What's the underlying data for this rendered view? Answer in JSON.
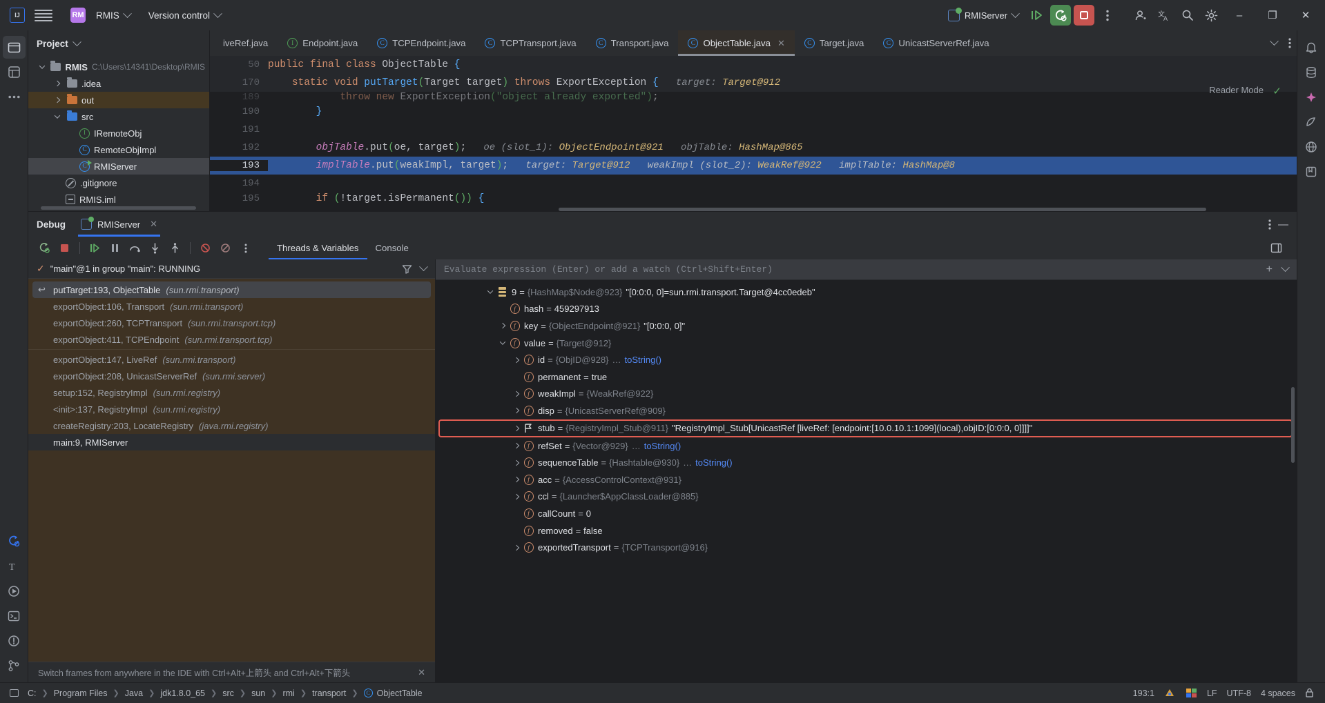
{
  "titlebar": {
    "logo_alt": "intellij-idea-logo",
    "project_badge": "RM",
    "project_name": "RMIS",
    "vcs_label": "Version control",
    "run_config": "RMIServer",
    "buttons": {
      "run": "Run",
      "debug": "Debug",
      "stop": "Stop",
      "more": "More Actions",
      "account": "Account",
      "translate": "Translate",
      "search": "Search Everywhere",
      "settings": "Settings",
      "minimize": "–",
      "maximize": "❐",
      "close": "✕"
    }
  },
  "project_pane": {
    "title": "Project",
    "tree": [
      {
        "label": "RMIS",
        "path": "C:\\Users\\14341\\Desktop\\RMIS",
        "icon": "module-folder-icon",
        "arrow": "down",
        "indent": 0,
        "bold": true,
        "state": "normal"
      },
      {
        "label": ".idea",
        "path": "",
        "icon": "folder-grey-icon",
        "arrow": "right",
        "indent": 1,
        "bold": false,
        "state": "normal"
      },
      {
        "label": "out",
        "path": "",
        "icon": "folder-orange-icon",
        "arrow": "right",
        "indent": 1,
        "bold": false,
        "state": "out-highlight"
      },
      {
        "label": "src",
        "path": "",
        "icon": "folder-blue-icon",
        "arrow": "down",
        "indent": 1,
        "bold": false,
        "state": "normal"
      },
      {
        "label": "IRemoteObj",
        "path": "",
        "icon": "interface-icon",
        "arrow": "",
        "indent": 2,
        "bold": false,
        "state": "normal"
      },
      {
        "label": "RemoteObjImpl",
        "path": "",
        "icon": "class-icon",
        "arrow": "",
        "indent": 2,
        "bold": false,
        "state": "normal"
      },
      {
        "label": "RMIServer",
        "path": "",
        "icon": "runnable-class-icon",
        "arrow": "",
        "indent": 2,
        "bold": false,
        "state": "selected"
      },
      {
        "label": ".gitignore",
        "path": "",
        "icon": "gitignore-icon",
        "arrow": "",
        "indent": 1,
        "bold": false,
        "state": "normal"
      },
      {
        "label": "RMIS.iml",
        "path": "",
        "icon": "iml-icon",
        "arrow": "",
        "indent": 1,
        "bold": false,
        "state": "normal"
      }
    ]
  },
  "editor": {
    "tabs": [
      {
        "label": "iveRef.java",
        "icon": "class-icon",
        "active": false,
        "clipped": true,
        "closable": false
      },
      {
        "label": "Endpoint.java",
        "icon": "interface-icon",
        "active": false,
        "clipped": false,
        "closable": false
      },
      {
        "label": "TCPEndpoint.java",
        "icon": "class-icon",
        "active": false,
        "clipped": false,
        "closable": false
      },
      {
        "label": "TCPTransport.java",
        "icon": "class-icon",
        "active": false,
        "clipped": false,
        "closable": false
      },
      {
        "label": "Transport.java",
        "icon": "class-icon",
        "active": false,
        "clipped": false,
        "closable": false
      },
      {
        "label": "ObjectTable.java",
        "icon": "class-modified-icon",
        "active": true,
        "clipped": false,
        "closable": true
      },
      {
        "label": "Target.java",
        "icon": "class-modified-icon",
        "active": false,
        "clipped": false,
        "closable": false
      },
      {
        "label": "UnicastServerRef.java",
        "icon": "class-icon",
        "active": false,
        "clipped": false,
        "closable": false
      }
    ],
    "tab_actions": {
      "chevron": "chevron-down-icon",
      "more": "more-icon"
    },
    "reader_mode": "Reader Mode",
    "sticky_lines": [
      {
        "number": "50",
        "indent": 1,
        "tokens": [
          {
            "t": "public",
            "c": "k"
          },
          {
            "t": " ",
            "c": "t"
          },
          {
            "t": "final",
            "c": "k"
          },
          {
            "t": " ",
            "c": "t"
          },
          {
            "t": "class",
            "c": "k"
          },
          {
            "t": " ",
            "c": "t"
          },
          {
            "t": "ObjectTable",
            "c": "t"
          },
          {
            "t": " ",
            "c": "t"
          },
          {
            "t": "{",
            "c": "br"
          }
        ]
      },
      {
        "number": "170",
        "indent": 2,
        "tokens": [
          {
            "t": "static",
            "c": "k"
          },
          {
            "t": " ",
            "c": "t"
          },
          {
            "t": "void",
            "c": "k"
          },
          {
            "t": " ",
            "c": "t"
          },
          {
            "t": "putTarget",
            "c": "m"
          },
          {
            "t": "(",
            "c": "g"
          },
          {
            "t": "Target target",
            "c": "t"
          },
          {
            "t": ")",
            "c": "g"
          },
          {
            "t": " ",
            "c": "t"
          },
          {
            "t": "throws",
            "c": "k"
          },
          {
            "t": " ",
            "c": "t"
          },
          {
            "t": "ExportException",
            "c": "t"
          },
          {
            "t": " ",
            "c": "t"
          },
          {
            "t": "{",
            "c": "br"
          },
          {
            "t": "   target: ",
            "c": "hint"
          },
          {
            "t": "Target@912",
            "c": "hintv"
          }
        ]
      }
    ],
    "lines": [
      {
        "number": "189",
        "highlight": false,
        "partial": true,
        "tokens": [
          {
            "t": "            ",
            "c": "t"
          },
          {
            "t": "throw",
            "c": "k"
          },
          {
            "t": " ",
            "c": "t"
          },
          {
            "t": "new",
            "c": "k"
          },
          {
            "t": " ",
            "c": "t"
          },
          {
            "t": "ExportException",
            "c": "t"
          },
          {
            "t": "(",
            "c": "g"
          },
          {
            "t": "\"object already exported\"",
            "c": "s"
          },
          {
            "t": ")",
            "c": "g"
          },
          {
            "t": ";",
            "c": "t"
          }
        ]
      },
      {
        "number": "190",
        "highlight": false,
        "partial": false,
        "tokens": [
          {
            "t": "        ",
            "c": "t"
          },
          {
            "t": "}",
            "c": "br"
          }
        ]
      },
      {
        "number": "191",
        "highlight": false,
        "partial": false,
        "tokens": []
      },
      {
        "number": "192",
        "highlight": false,
        "partial": false,
        "tokens": [
          {
            "t": "        ",
            "c": "t"
          },
          {
            "t": "objTable",
            "c": "f"
          },
          {
            "t": ".",
            "c": "t"
          },
          {
            "t": "put",
            "c": "t"
          },
          {
            "t": "(",
            "c": "g"
          },
          {
            "t": "oe, target",
            "c": "t"
          },
          {
            "t": ")",
            "c": "g"
          },
          {
            "t": ";",
            "c": "t"
          },
          {
            "t": "   oe (slot_1): ",
            "c": "hint"
          },
          {
            "t": "ObjectEndpoint@921",
            "c": "hintv"
          },
          {
            "t": "   objTable: ",
            "c": "hint"
          },
          {
            "t": "HashMap@865",
            "c": "hintv"
          }
        ]
      },
      {
        "number": "193",
        "highlight": true,
        "partial": false,
        "tokens": [
          {
            "t": "        ",
            "c": "t"
          },
          {
            "t": "implTable",
            "c": "f"
          },
          {
            "t": ".",
            "c": "t"
          },
          {
            "t": "put",
            "c": "t"
          },
          {
            "t": "(",
            "c": "g"
          },
          {
            "t": "weakImpl, target",
            "c": "t"
          },
          {
            "t": ")",
            "c": "g"
          },
          {
            "t": ";",
            "c": "t"
          },
          {
            "t": "   target: ",
            "c": "hint"
          },
          {
            "t": "Target@912",
            "c": "hintv"
          },
          {
            "t": "   weakImpl (slot_2): ",
            "c": "hint"
          },
          {
            "t": "WeakRef@922",
            "c": "hintv"
          },
          {
            "t": "   implTable: ",
            "c": "hint"
          },
          {
            "t": "HashMap@8",
            "c": "hintv"
          }
        ]
      },
      {
        "number": "194",
        "highlight": false,
        "partial": false,
        "tokens": []
      },
      {
        "number": "195",
        "highlight": false,
        "partial": false,
        "tokens": [
          {
            "t": "        ",
            "c": "t"
          },
          {
            "t": "if",
            "c": "k"
          },
          {
            "t": " ",
            "c": "t"
          },
          {
            "t": "(",
            "c": "g"
          },
          {
            "t": "!target.isPermanent",
            "c": "t"
          },
          {
            "t": "()",
            "c": "g"
          },
          {
            "t": ")",
            "c": "g"
          },
          {
            "t": " ",
            "c": "t"
          },
          {
            "t": "{",
            "c": "br"
          }
        ]
      }
    ]
  },
  "debug": {
    "panel_title": "Debug",
    "session_tab": "RMIServer",
    "session_close": "✕",
    "toolbar_buttons": [
      "rerun-icon",
      "stop-icon",
      "resume-icon",
      "pause-icon",
      "step-over-icon",
      "step-into-icon",
      "step-out-icon",
      "mute-breakpoints-icon",
      "view-breakpoints-icon",
      "more-icon"
    ],
    "tabs": [
      {
        "label": "Threads & Variables",
        "active": true
      },
      {
        "label": "Console",
        "active": false
      }
    ],
    "layout_button": "layout-settings-icon",
    "thread_status": "\"main\"@1 in group \"main\": RUNNING",
    "filter_icon": "filter-icon",
    "frames": [
      {
        "text": "putTarget:193, ObjectTable",
        "pkg": "(sun.rmi.transport)",
        "selected": true
      },
      {
        "text": "exportObject:106, Transport",
        "pkg": "(sun.rmi.transport)",
        "selected": false
      },
      {
        "text": "exportObject:260, TCPTransport",
        "pkg": "(sun.rmi.transport.tcp)",
        "selected": false
      },
      {
        "text": "exportObject:411, TCPEndpoint",
        "pkg": "(sun.rmi.transport.tcp)",
        "selected": false
      },
      {
        "text": "exportObject:147, LiveRef",
        "pkg": "(sun.rmi.transport)",
        "selected": false
      },
      {
        "text": "exportObject:208, UnicastServerRef",
        "pkg": "(sun.rmi.server)",
        "selected": false
      },
      {
        "text": "setup:152, RegistryImpl",
        "pkg": "(sun.rmi.registry)",
        "selected": false
      },
      {
        "text": "<init>:137, RegistryImpl",
        "pkg": "(sun.rmi.registry)",
        "selected": false
      },
      {
        "text": "createRegistry:203, LocateRegistry",
        "pkg": "(java.rmi.registry)",
        "selected": false
      },
      {
        "text": "main:9, RMIServer",
        "pkg": "",
        "selected": false
      }
    ],
    "hint_bar": "Switch frames from anywhere in the IDE with Ctrl+Alt+上箭头 and Ctrl+Alt+下箭头",
    "hint_close": "✕",
    "eval_placeholder": "Evaluate expression (Enter) or add a watch (Ctrl+Shift+Enter)",
    "eval_add": "add-watch-icon",
    "eval_chevron": "chevron-down-icon",
    "variables": [
      {
        "indent": 0,
        "arrow": "down",
        "icon": "map-entry-icon",
        "name": "9",
        "type": "{HashMap$Node@923}",
        "value": "\"[0:0:0, 0]=sun.rmi.transport.Target@4cc0edeb\"",
        "link": "",
        "boxed": false
      },
      {
        "indent": 1,
        "arrow": "",
        "icon": "private-field-icon",
        "name": "hash",
        "type": "",
        "value": "459297913",
        "link": "",
        "boxed": false
      },
      {
        "indent": 1,
        "arrow": "right",
        "icon": "private-field-icon",
        "name": "key",
        "type": "{ObjectEndpoint@921}",
        "value": "\"[0:0:0, 0]\"",
        "link": "",
        "boxed": false
      },
      {
        "indent": 1,
        "arrow": "down",
        "icon": "field-icon",
        "name": "value",
        "type": "{Target@912}",
        "value": "",
        "link": "",
        "boxed": false
      },
      {
        "indent": 2,
        "arrow": "right",
        "icon": "private-field-icon",
        "name": "id",
        "type": "{ObjID@928}",
        "value": "…",
        "link": "toString()",
        "boxed": false
      },
      {
        "indent": 2,
        "arrow": "",
        "icon": "private-field-icon",
        "name": "permanent",
        "type": "",
        "value": "true",
        "link": "",
        "boxed": false
      },
      {
        "indent": 2,
        "arrow": "right",
        "icon": "private-field-icon",
        "name": "weakImpl",
        "type": "{WeakRef@922}",
        "value": "",
        "link": "",
        "boxed": false
      },
      {
        "indent": 2,
        "arrow": "right",
        "icon": "private-field-icon",
        "name": "disp",
        "type": "{UnicastServerRef@909}",
        "value": "",
        "link": "",
        "boxed": false
      },
      {
        "indent": 2,
        "arrow": "right",
        "icon": "watched-field-icon",
        "name": "stub",
        "type": "{RegistryImpl_Stub@911}",
        "value": "\"RegistryImpl_Stub[UnicastRef [liveRef: [endpoint:[10.0.10.1:1099](local),objID:[0:0:0, 0]]]]\"",
        "link": "",
        "boxed": true
      },
      {
        "indent": 2,
        "arrow": "right",
        "icon": "private-field-icon",
        "name": "refSet",
        "type": "{Vector@929}",
        "value": "…",
        "link": "toString()",
        "boxed": false
      },
      {
        "indent": 2,
        "arrow": "right",
        "icon": "private-field-icon",
        "name": "sequenceTable",
        "type": "{Hashtable@930}",
        "value": "…",
        "link": "toString()",
        "boxed": false
      },
      {
        "indent": 2,
        "arrow": "right",
        "icon": "private-field-icon",
        "name": "acc",
        "type": "{AccessControlContext@931}",
        "value": "",
        "link": "",
        "boxed": false
      },
      {
        "indent": 2,
        "arrow": "right",
        "icon": "private-field-icon",
        "name": "ccl",
        "type": "{Launcher$AppClassLoader@885}",
        "value": "",
        "link": "",
        "boxed": false
      },
      {
        "indent": 2,
        "arrow": "",
        "icon": "field-icon",
        "name": "callCount",
        "type": "",
        "value": "0",
        "link": "",
        "boxed": false
      },
      {
        "indent": 2,
        "arrow": "",
        "icon": "field-icon",
        "name": "removed",
        "type": "",
        "value": "false",
        "link": "",
        "boxed": false
      },
      {
        "indent": 2,
        "arrow": "right",
        "icon": "field-icon",
        "name": "exportedTransport",
        "type": "{TCPTransport@916}",
        "value": "",
        "link": "",
        "boxed": false
      }
    ]
  },
  "statusbar": {
    "drive": "C:",
    "breadcrumbs": [
      "Program Files",
      "Java",
      "jdk1.8.0_65",
      "src",
      "sun",
      "rmi",
      "transport",
      "ObjectTable"
    ],
    "breadcrumb_last_icon": "class-icon",
    "caret": "193:1",
    "icons": [
      "git-branch-icon",
      "ide-features-icon"
    ],
    "line_separator": "LF",
    "encoding": "UTF-8",
    "indent": "4 spaces",
    "lock": "lock-icon"
  },
  "colors": {
    "accent_blue": "#3574f0",
    "debug_green": "#4c8a52",
    "stop_red": "#c75450",
    "highlight_line": "#2f5596",
    "frames_bg": "#3e3223",
    "box_red": "#e05d52",
    "editor_bg": "#1e1f22",
    "chrome_bg": "#2b2d30"
  }
}
